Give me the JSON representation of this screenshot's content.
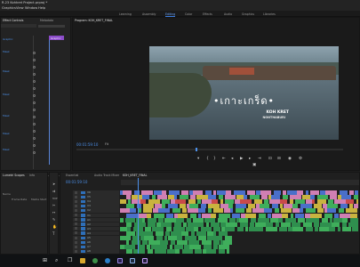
{
  "window": {
    "title": "R-23 Kohkret Project.prproj *"
  },
  "menu": [
    "Graphics",
    "View",
    "Window",
    "Help"
  ],
  "workspaces": [
    {
      "label": "Learning",
      "active": false
    },
    {
      "label": "Assembly",
      "active": false
    },
    {
      "label": "Editing",
      "active": true
    },
    {
      "label": "Color",
      "active": false
    },
    {
      "label": "Effects",
      "active": false
    },
    {
      "label": "Audio",
      "active": false
    },
    {
      "label": "Graphics",
      "active": false
    },
    {
      "label": "Libraries",
      "active": false
    }
  ],
  "effect_controls": {
    "tab_label": "Effect Controls",
    "other_tab": "Metadata",
    "clip_label": "Graphic",
    "timecode": "00:01:59:10",
    "rows": [
      "Graphic",
      "Mask",
      "Mask",
      "Mask",
      "Mask",
      "Mask",
      "Mask",
      "Mask",
      "Mask"
    ]
  },
  "program_monitor": {
    "tab_label": "Program: KOH_KRET_FINAL",
    "title_text": "•เกาะเกร็ด•",
    "subtitle_line1": "KOH KRET",
    "subtitle_line2": "NONTHABURI",
    "timecode": "00:01:59:10",
    "zoom": "Fit",
    "controls": [
      "marker-icon",
      "in-icon",
      "out-icon",
      "go-in-icon",
      "step-back-icon",
      "play-icon",
      "step-forward-icon",
      "go-out-icon",
      "lift-icon",
      "extract-icon",
      "export-frame-icon",
      "settings-icon"
    ]
  },
  "project_panel": {
    "tabs": [
      "Lumetri Scopes",
      "Info"
    ],
    "items": [
      "Name",
      "Frame Rate",
      "Media Start"
    ]
  },
  "timeline": {
    "tabs": [
      "Essential",
      "Audio Track Mixer",
      "KOH_KRET_FINAL"
    ],
    "timecode": "00:01:59:10",
    "tracks": [
      "V6",
      "V5",
      "V4",
      "V3",
      "V2",
      "V1",
      "A1",
      "A2",
      "A3",
      "A4",
      "A5",
      "A6",
      "A7",
      "A8"
    ]
  },
  "taskbar": {
    "icons": [
      "windows-start-icon",
      "search-icon",
      "task-view-icon",
      "file-explorer-icon",
      "chrome-icon",
      "edge-icon",
      "premiere-icon",
      "media-encoder-icon",
      "after-effects-icon"
    ]
  },
  "colors": {
    "accent": "#2e6fb8",
    "selection": "#8b4cc9",
    "clip_blue": "#4a6fc9",
    "clip_pink": "#d07fb3",
    "clip_green": "#3fae5b",
    "clip_yellow": "#c9b33f",
    "clip_red": "#c94a4a"
  }
}
